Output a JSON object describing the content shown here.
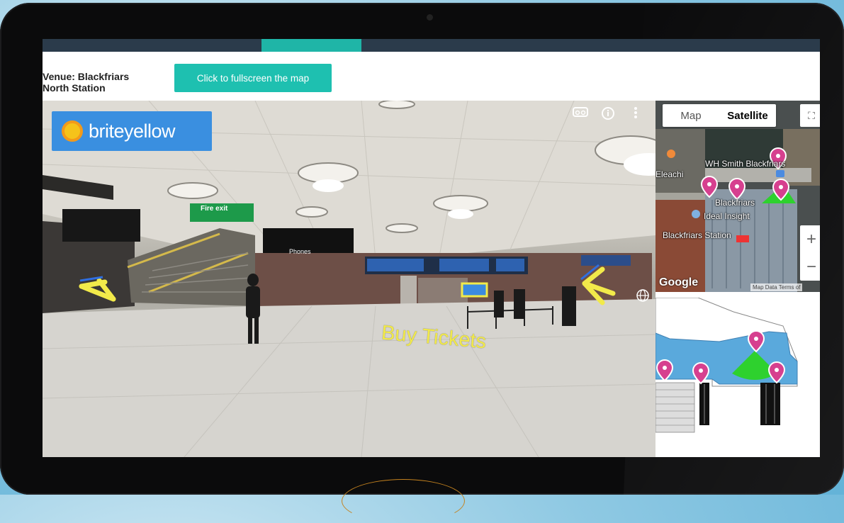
{
  "venue": {
    "line1": "Venue: Blackfriars",
    "line2": "North Station"
  },
  "fullscreen_button": {
    "label": "Click to fullscreen the map"
  },
  "brand": {
    "name": "briteyellow"
  },
  "panorama": {
    "annotation": "Buy Tickets",
    "fire_exit_sign": "Fire exit",
    "phones_sign": "Phones",
    "controls": [
      "vr-icon",
      "info-icon",
      "more-icon",
      "globe-icon"
    ]
  },
  "map": {
    "type_options": [
      "Map",
      "Satellite"
    ],
    "selected_type": "Satellite",
    "labels": {
      "wh_smith": "WH Smith Blackfriars",
      "eleachi": "Eleachi",
      "blackfriars": "Blackfriars",
      "ideal_insight": "Ideal Insight",
      "blackfriars_station": "Blackfriars Station"
    },
    "zoom_in": "+",
    "zoom_out": "−",
    "attribution_logo": "Google",
    "attribution_text": "Map Data  Terms of"
  },
  "colors": {
    "accent": "#1ec0b0",
    "topbar": "#2b3b4b",
    "brand_blue": "#3a8fe0",
    "marker": "#d6408f",
    "annotation": "#f2ea4a",
    "floor_blue": "#5aa9dc"
  }
}
